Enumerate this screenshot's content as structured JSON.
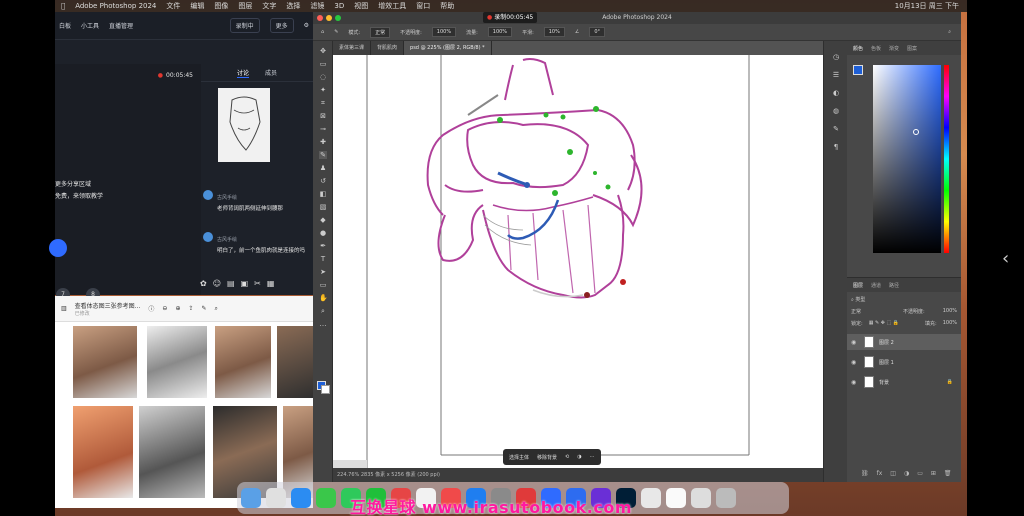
{
  "menubar": {
    "app": "Adobe Photoshop 2024",
    "items": [
      "文件",
      "编辑",
      "图像",
      "图层",
      "文字",
      "选择",
      "滤镜",
      "3D",
      "视图",
      "增效工具",
      "窗口",
      "帮助"
    ],
    "clock": "10月13日 周三 下午"
  },
  "meeting": {
    "toolbar": {
      "item1": "白板",
      "item2": "小工具",
      "item3": "直播管理",
      "btn_record": "录制中",
      "btn_more": "更多"
    },
    "timer": "00:05:45",
    "video_lines": [
      "更多分享区域",
      "免费，来领取教学"
    ],
    "tabs": {
      "chat": "讨论",
      "members": "成员"
    },
    "messages": [
      {
        "name": "古风手绘",
        "body": "老师背阔肌两侧延伸到腰那"
      },
      {
        "name": "古风手绘",
        "body": "明白了，前一个鱼肌肉就是连接的吗"
      }
    ],
    "badges": {
      "b1": "7",
      "b2": "8"
    }
  },
  "reference_browser": {
    "title": "查看体态图三张参考图...",
    "subtitle": "已修改"
  },
  "photoshop": {
    "window_title": "Adobe Photoshop 2024",
    "recording_badge": "录制00:05:45",
    "options": {
      "mode_label": "模式:",
      "mode_value": "正常",
      "opacity_label": "不透明度:",
      "opacity_value": "100%",
      "flow_label": "流量:",
      "flow_value": "100%",
      "smooth_label": "平滑:",
      "smooth_value": "10%",
      "angle_value": "0°"
    },
    "doc_tabs": [
      "素体第三课",
      "背肌肌肉",
      "psd @ 225% (图层 2, RGB/8) *"
    ],
    "status": "224.76%    2835 像素 x 5256 像素 (200 ppi)",
    "context_bar": {
      "select_subject": "选择主体",
      "remove_bg": "移除背景"
    },
    "color_panel_tabs": [
      "颜色",
      "色板",
      "渐变",
      "图案"
    ],
    "layers_panel_tabs": [
      "图层",
      "通道",
      "路径"
    ],
    "layers_kind": "类型",
    "blend_mode": "正常",
    "opacity_label": "不透明度:",
    "opacity_value": "100%",
    "lock_label": "锁定:",
    "fill_label": "填充:",
    "fill_value": "100%",
    "layers": [
      {
        "name": "图层 2",
        "selected": true
      },
      {
        "name": "图层 1",
        "selected": false
      },
      {
        "name": "背景",
        "selected": false
      }
    ]
  },
  "watermark": "互换星球 www.irasutobook.com"
}
